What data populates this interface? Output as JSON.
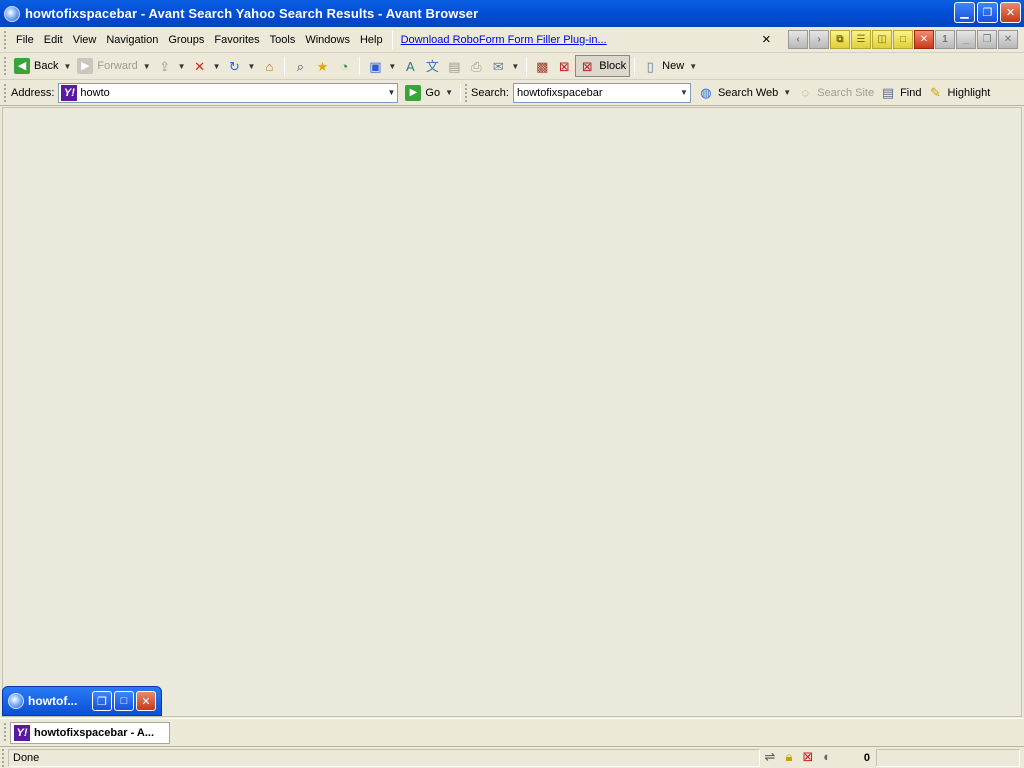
{
  "window": {
    "title": "howtofixspacebar - Avant Search Yahoo Search Results - Avant Browser",
    "buttons": [
      "minimize",
      "restore",
      "close"
    ]
  },
  "menubar": {
    "items": [
      "File",
      "Edit",
      "View",
      "Navigation",
      "Groups",
      "Favorites",
      "Tools",
      "Windows",
      "Help"
    ],
    "promo_link": "Download RoboForm Form Filler Plug-in...",
    "promo_close": "×",
    "page_counter": "1"
  },
  "toolbar": {
    "back": "Back",
    "forward": "Forward",
    "block": "Block",
    "new": "New"
  },
  "addressbar": {
    "address_label": "Address:",
    "address_value": "howto",
    "go": "Go",
    "search_label": "Search:",
    "search_value": "howtofixspacebar",
    "search_web": "Search Web",
    "search_site": "Search Site",
    "find": "Find",
    "highlight": "Highlight"
  },
  "mini_window": {
    "title": "howtof..."
  },
  "tabs": [
    {
      "label": "howtofixspacebar - A..."
    }
  ],
  "status": {
    "text": "Done",
    "blocked_count": "0"
  },
  "colors": {
    "titlebar": "#0251d6",
    "content_bg": "#ebe9dc",
    "chrome_bg": "#ece9d8",
    "link": "#0000ee"
  }
}
